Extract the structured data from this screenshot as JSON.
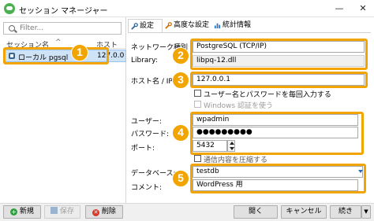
{
  "window": {
    "title": "セッション マネージャー",
    "minimize": "—",
    "close": "✕"
  },
  "left": {
    "filter_placeholder": "Filter...",
    "col_name": "セッション名",
    "col_name_sort": "^",
    "col_host": "ホスト",
    "session_name": "ローカル pgsql",
    "session_host": "127.0.0"
  },
  "tabs": [
    {
      "label": "設定",
      "icon": "wrench-icon"
    },
    {
      "label": "高度な設定",
      "icon": "wrench-icon"
    },
    {
      "label": "統計情報",
      "icon": "bar-chart-icon"
    }
  ],
  "form": {
    "network_type_label": "ネットワーク種別",
    "network_type_value": "PostgreSQL (TCP/IP)",
    "library_label": "Library:",
    "library_value": "libpq-12.dll",
    "host_label": "ホスト名 / IP:",
    "host_value": "127.0.0.1",
    "prompt_credentials_label": "ユーザー名とパスワードを毎回入力する",
    "windows_auth_label": "Windows 認証を使う",
    "user_label": "ユーザー:",
    "user_value": "wpadmin",
    "password_label": "パスワード:",
    "password_value": "●●●●●●●●●",
    "port_label": "ポート:",
    "port_value": "5432",
    "compress_label": "通信内容を圧縮する",
    "database_label": "データベース:",
    "database_value": "testdb",
    "comment_label": "コメント:",
    "comment_value": "WordPress 用"
  },
  "bottom": {
    "new_label": "新規",
    "save_label": "保存",
    "delete_label": "削除",
    "open_label": "開く",
    "cancel_label": "キャンセル",
    "more_label": "続き"
  },
  "badges": [
    "1",
    "2",
    "3",
    "4",
    "5"
  ],
  "colors": {
    "highlight": "#f2a500",
    "selection": "#cfe3f7"
  }
}
